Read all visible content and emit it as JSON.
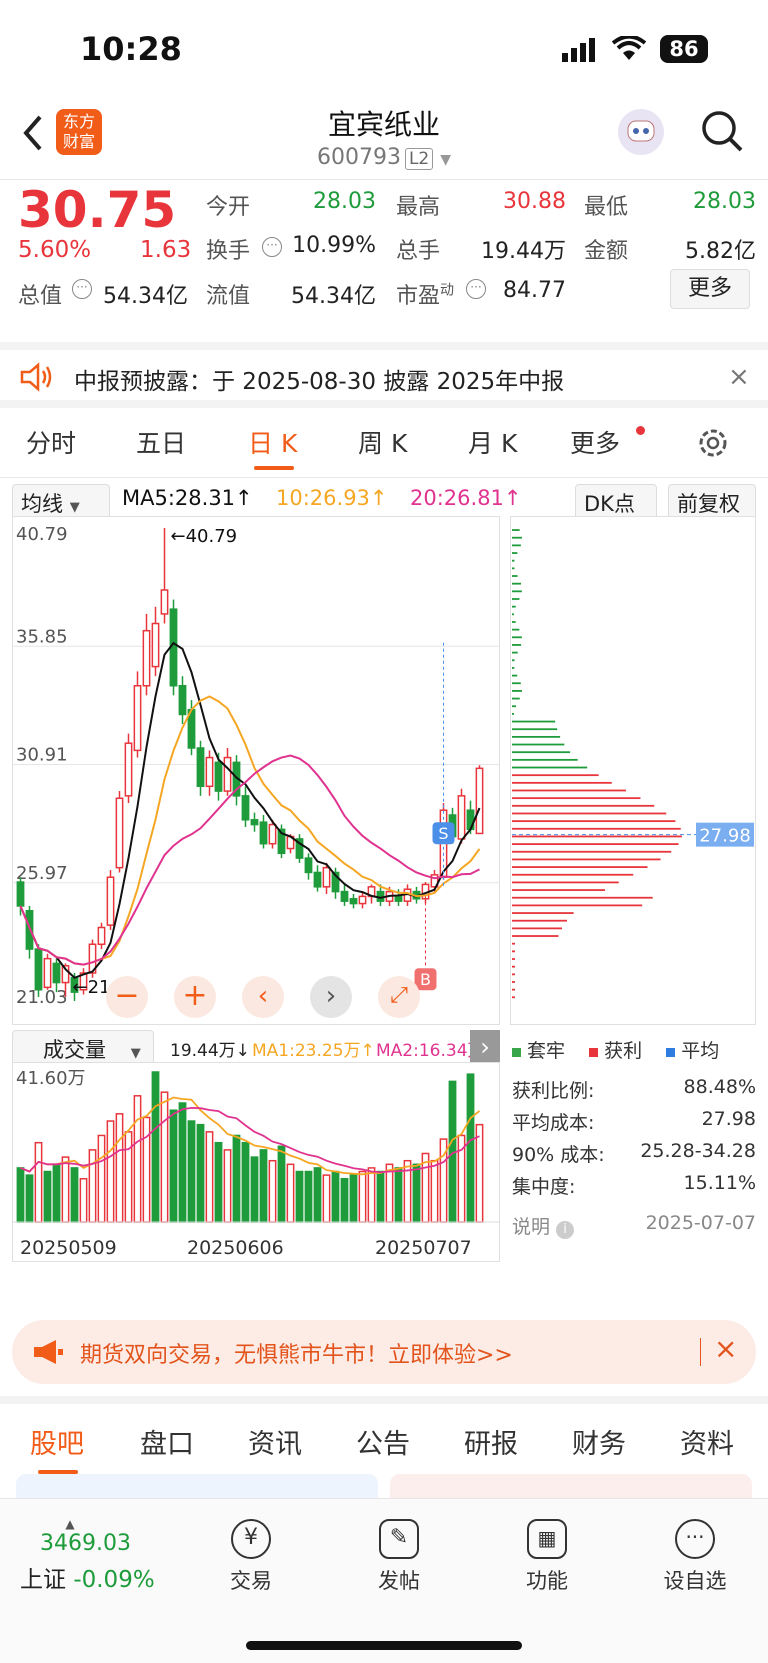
{
  "status": {
    "time": "10:28",
    "battery": "86"
  },
  "header": {
    "title": "宜宾纸业",
    "code": "600793",
    "level": "L2",
    "logo_line1": "东方",
    "logo_line2": "财富"
  },
  "quote": {
    "price": "30.75",
    "change_pct": "5.60%",
    "change": "1.63",
    "open_label": "今开",
    "open": "28.03",
    "high_label": "最高",
    "high": "30.88",
    "low_label": "最低",
    "low": "28.03",
    "turnover_label": "换手",
    "turnover": "10.99%",
    "volume_label": "总手",
    "volume": "19.44万",
    "amount_label": "金额",
    "amount": "5.82亿",
    "mcap_label": "总值",
    "mcap": "54.34亿",
    "float_label": "流值",
    "float": "54.34亿",
    "pe_label": "市盈",
    "pe_sup": "动",
    "pe": "84.77",
    "more_label": "更多"
  },
  "notice": {
    "text": "中报预披露：于 2025-08-30 披露 2025年中报"
  },
  "tabs": [
    "分时",
    "五日",
    "日 K",
    "周 K",
    "月 K",
    "更多"
  ],
  "ma_bar": {
    "selector": "均线",
    "ma5": "MA5:28.31↑",
    "ma10": "10:26.93↑",
    "ma20": "20:26.81↑",
    "dk": "DK点",
    "adj": "前复权"
  },
  "colors": {
    "up": "#e8353b",
    "down": "#1e9b3a",
    "ma5": "#111111",
    "ma10": "#f5a623",
    "ma20": "#e0338f",
    "accent": "#f25c19"
  },
  "chart_data": {
    "type": "candlestick",
    "price_axis_labels": [
      "40.79",
      "35.85",
      "30.91",
      "25.97",
      "21.03"
    ],
    "ylim": [
      21.03,
      40.79
    ],
    "max_label": "40.79",
    "min_label": "21.03",
    "cost_label": "27.98",
    "x_labels": [
      "20250509",
      "20250606",
      "20250707"
    ],
    "signals": [
      "S",
      "B"
    ],
    "candles": [
      [
        26.0,
        25.0,
        26.2,
        24.6
      ],
      [
        24.8,
        23.2,
        25.0,
        22.8
      ],
      [
        23.2,
        21.5,
        23.4,
        21.2
      ],
      [
        21.6,
        22.8,
        23.0,
        21.5
      ],
      [
        22.6,
        21.8,
        22.8,
        21.4
      ],
      [
        21.8,
        22.5,
        22.6,
        21.2
      ],
      [
        22.0,
        21.4,
        22.2,
        21.03
      ],
      [
        21.5,
        22.2,
        22.4,
        21.3
      ],
      [
        22.2,
        23.4,
        23.6,
        22.0
      ],
      [
        23.4,
        24.1,
        24.3,
        23.2
      ],
      [
        24.2,
        26.2,
        26.5,
        24.0
      ],
      [
        26.6,
        29.5,
        29.8,
        26.4
      ],
      [
        29.6,
        31.8,
        32.2,
        29.3
      ],
      [
        31.5,
        34.2,
        34.8,
        31.2
      ],
      [
        34.2,
        36.5,
        37.2,
        33.8
      ],
      [
        35.0,
        36.8,
        37.5,
        34.6
      ],
      [
        37.2,
        38.2,
        40.79,
        36.8
      ],
      [
        37.4,
        34.2,
        37.8,
        33.8
      ],
      [
        34.2,
        33.0,
        34.6,
        32.6
      ],
      [
        33.2,
        31.6,
        33.6,
        31.3
      ],
      [
        31.6,
        30.0,
        31.9,
        29.6
      ],
      [
        30.0,
        31.2,
        31.5,
        29.6
      ],
      [
        31.0,
        29.8,
        31.4,
        29.4
      ],
      [
        29.8,
        31.2,
        31.6,
        29.6
      ],
      [
        31.0,
        29.6,
        31.3,
        29.2
      ],
      [
        29.6,
        28.6,
        30.0,
        28.3
      ],
      [
        28.6,
        28.4,
        28.9,
        28.1
      ],
      [
        28.5,
        27.6,
        28.8,
        27.4
      ],
      [
        27.6,
        28.4,
        28.6,
        27.4
      ],
      [
        28.2,
        27.2,
        28.4,
        27.0
      ],
      [
        27.4,
        27.9,
        28.0,
        27.2
      ],
      [
        27.8,
        27.0,
        28.0,
        26.8
      ],
      [
        27.0,
        26.4,
        27.2,
        26.1
      ],
      [
        26.4,
        25.8,
        26.7,
        25.6
      ],
      [
        25.8,
        26.6,
        26.8,
        25.5
      ],
      [
        26.4,
        25.6,
        26.6,
        25.3
      ],
      [
        25.6,
        25.2,
        25.9,
        25.0
      ],
      [
        25.3,
        25.1,
        25.5,
        24.9
      ],
      [
        25.1,
        25.4,
        25.6,
        24.9
      ],
      [
        25.4,
        25.8,
        25.9,
        25.1
      ],
      [
        25.6,
        25.2,
        25.9,
        25.0
      ],
      [
        25.2,
        25.6,
        25.8,
        25.0
      ],
      [
        25.4,
        25.2,
        25.7,
        25.0
      ],
      [
        25.2,
        25.7,
        25.9,
        25.0
      ],
      [
        25.6,
        25.3,
        25.8,
        25.1
      ],
      [
        25.3,
        25.9,
        26.0,
        25.1
      ],
      [
        25.8,
        26.3,
        26.5,
        25.6
      ],
      [
        26.2,
        29.0,
        29.3,
        26.1
      ],
      [
        28.8,
        27.9,
        29.1,
        27.6
      ],
      [
        27.8,
        29.6,
        29.9,
        27.6
      ],
      [
        29.0,
        28.2,
        29.4,
        28.0
      ],
      [
        28.03,
        30.75,
        30.88,
        28.03
      ]
    ],
    "volume_axis_label": "41.60万",
    "volume_selector": "成交量",
    "volume_summary": {
      "vol": "19.44万↓",
      "ma1": "MA1:23.25万↑",
      "ma2": "MA2:16.34万"
    },
    "volumes": [
      15,
      13,
      22,
      14,
      16,
      18,
      15,
      12,
      20,
      24,
      28,
      30,
      25,
      35,
      29,
      41.6,
      36,
      31,
      33,
      28,
      27,
      25,
      22,
      20,
      24,
      22,
      18,
      20,
      17,
      21,
      16,
      14,
      14,
      15,
      13,
      14,
      12,
      13,
      14,
      15,
      14,
      16,
      15,
      17,
      16,
      19,
      17,
      23,
      39,
      24,
      41,
      27
    ],
    "volume_up": [
      false,
      false,
      true,
      false,
      false,
      true,
      false,
      true,
      true,
      true,
      true,
      true,
      true,
      true,
      true,
      false,
      true,
      false,
      false,
      false,
      false,
      true,
      false,
      true,
      false,
      false,
      false,
      false,
      true,
      false,
      true,
      false,
      false,
      false,
      true,
      false,
      false,
      false,
      true,
      true,
      false,
      true,
      false,
      true,
      false,
      true,
      true,
      true,
      false,
      true,
      false,
      true
    ]
  },
  "chip": {
    "legend": [
      "套牢",
      "获利",
      "平均"
    ],
    "rows": [
      {
        "label": "获利比例:",
        "value": "88.48%"
      },
      {
        "label": "平均成本:",
        "value": "27.98"
      },
      {
        "label": "90% 成本:",
        "value": "25.28-34.28"
      },
      {
        "label": "集中度:",
        "value": "15.11%"
      }
    ],
    "note_label": "说明",
    "date": "2025-07-07"
  },
  "banner": {
    "text": "期货双向交易，无惧熊市牛市！立即体验>>"
  },
  "bottom_tabs": [
    "股吧",
    "盘口",
    "资讯",
    "公告",
    "研报",
    "财务",
    "资料"
  ],
  "dock": {
    "index_value": "3469.03",
    "index_name": "上证",
    "index_change": "-0.09%",
    "items": [
      "交易",
      "发帖",
      "功能",
      "设自选"
    ]
  }
}
